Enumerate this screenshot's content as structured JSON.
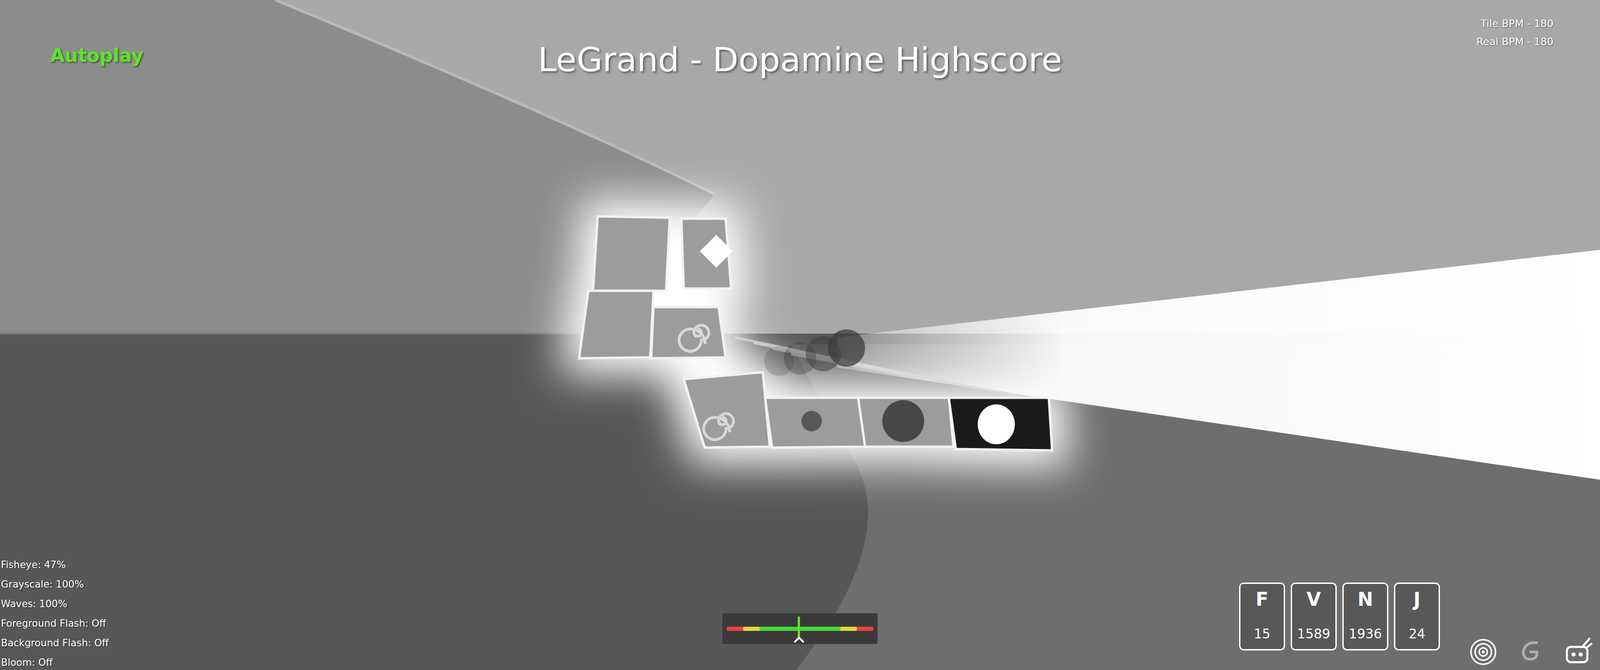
{
  "mode": {
    "label": "Autoplay"
  },
  "song": {
    "title": "LeGrand - Dopamine Highscore"
  },
  "bpm": [
    "Tile BPM - 180",
    "Real BPM - 180"
  ],
  "settings": [
    "Fisheye: 47%",
    "Grayscale: 100%",
    "Waves: 100%",
    "Foreground Flash: Off",
    "Background Flash: Off",
    "Bloom: Off"
  ],
  "timing_meter": {
    "level": 0.5
  },
  "judgments": [
    {
      "label": "F",
      "count": "15"
    },
    {
      "label": "V",
      "count": "1589"
    },
    {
      "label": "N",
      "count": "1936"
    },
    {
      "label": "J",
      "count": "24"
    }
  ],
  "toolbar_buttons": [
    {
      "on": true
    },
    {
      "on": false
    },
    {
      "on": true
    }
  ]
}
